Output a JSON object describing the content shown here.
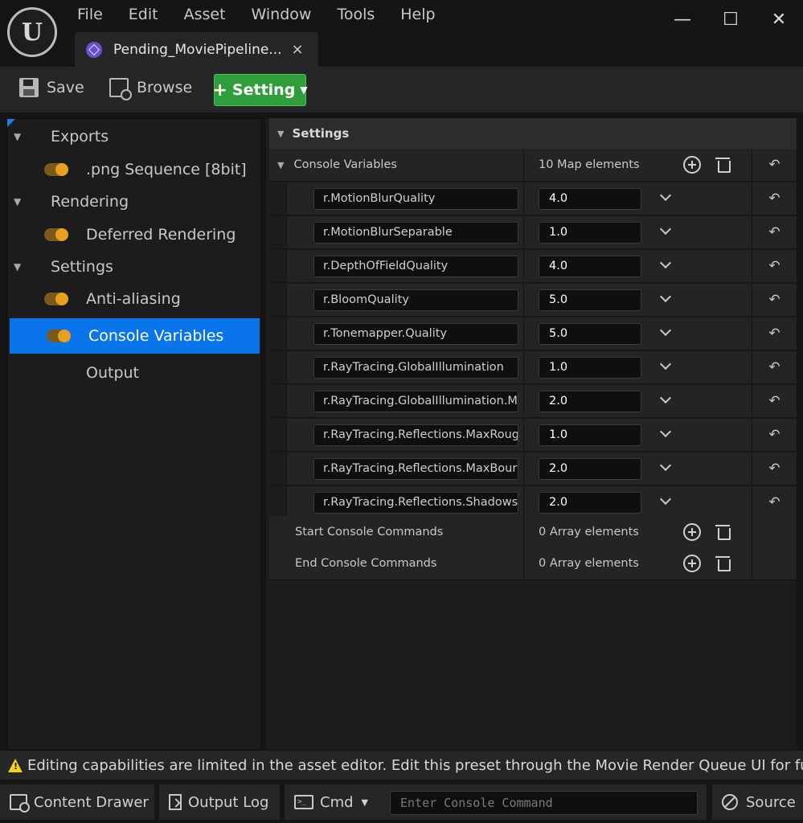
{
  "app": {
    "logo": "U",
    "menu": [
      "File",
      "Edit",
      "Asset",
      "Window",
      "Tools",
      "Help"
    ],
    "tab": {
      "title": "Pending_MoviePipeline...",
      "close": "×"
    },
    "window_controls": {
      "minimize": "—",
      "maximize": "☐",
      "close": "✕"
    }
  },
  "toolbar": {
    "save_label": "Save",
    "browse_label": "Browse",
    "setting_label": "Setting",
    "setting_plus": "+",
    "setting_caret": "▼"
  },
  "tree": {
    "groups": [
      {
        "label": "Exports",
        "caret": "▼",
        "items": [
          ".png Sequence [8bit]"
        ]
      },
      {
        "label": "Rendering",
        "caret": "▼",
        "items": [
          "Deferred Rendering"
        ]
      },
      {
        "label": "Settings",
        "caret": "▼",
        "items": [
          "Anti-aliasing",
          "Console Variables"
        ]
      }
    ],
    "output_label": "Output",
    "selected": "Console Variables"
  },
  "details": {
    "section_title": "Settings",
    "section_caret": "▼",
    "console_variables": {
      "label": "Console Variables",
      "caret": "▼",
      "count": "10 Map elements",
      "reset_glyph": "↶"
    },
    "variables": [
      {
        "key": "r.MotionBlurQuality",
        "value": "4.0"
      },
      {
        "key": "r.MotionBlurSeparable",
        "value": "1.0"
      },
      {
        "key": "r.DepthOfFieldQuality",
        "value": "4.0"
      },
      {
        "key": "r.BloomQuality",
        "value": "5.0"
      },
      {
        "key": "r.Tonemapper.Quality",
        "value": "5.0"
      },
      {
        "key": "r.RayTracing.GlobalIllumination",
        "value": "1.0"
      },
      {
        "key": "r.RayTracing.GlobalIllumination.M",
        "value": "2.0"
      },
      {
        "key": "r.RayTracing.Reflections.MaxRoug",
        "value": "1.0"
      },
      {
        "key": "r.RayTracing.Reflections.MaxBour",
        "value": "2.0"
      },
      {
        "key": "r.RayTracing.Reflections.Shadows",
        "value": "2.0"
      }
    ],
    "start_commands": {
      "label": "Start Console Commands",
      "count": "0 Array elements"
    },
    "end_commands": {
      "label": "End Console Commands",
      "count": "0 Array elements"
    }
  },
  "warning": {
    "text": "Editing capabilities are limited in the asset editor. Edit this preset through the Movie Render Queue UI for full e"
  },
  "statusbar": {
    "content_drawer": "Content Drawer",
    "output_log": "Output Log",
    "cmd_label": "Cmd",
    "cmd_caret": "▼",
    "cmd_icon_text": ">_",
    "console_placeholder": "Enter Console Command",
    "source_label": "Source"
  }
}
